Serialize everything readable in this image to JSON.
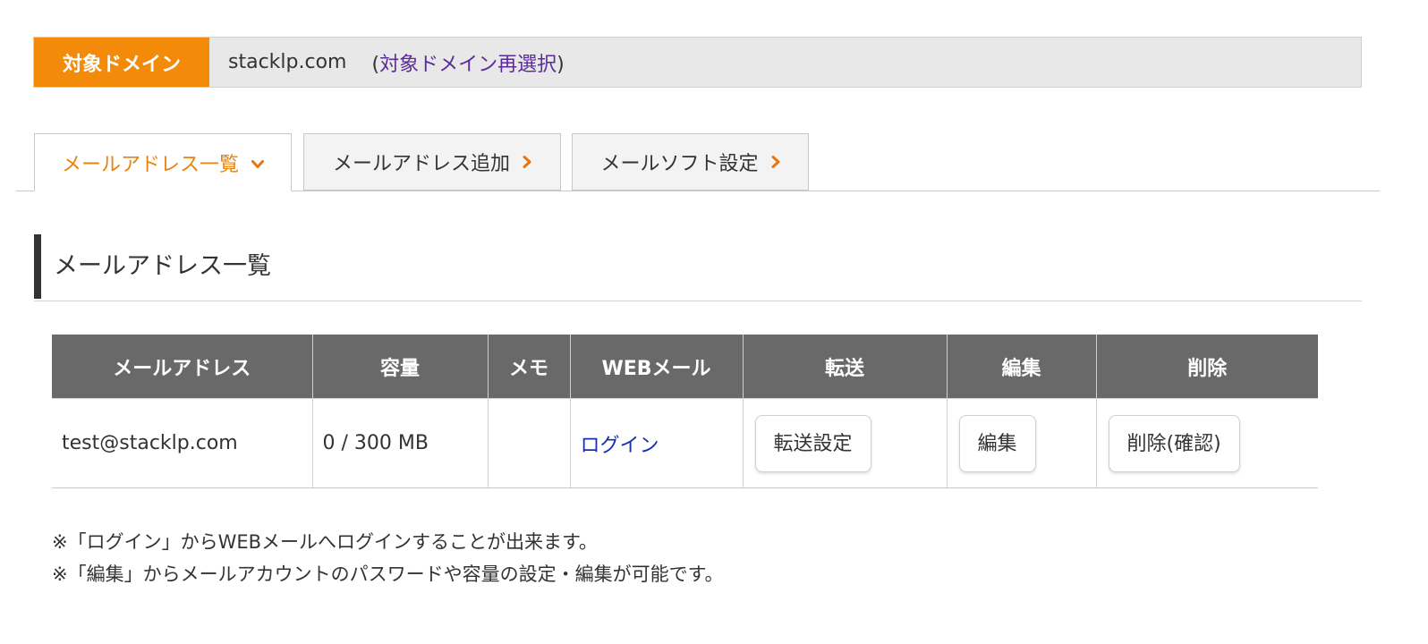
{
  "domain_bar": {
    "label": "対象ドメイン",
    "domain": "stacklp.com",
    "reselect_open": "(",
    "reselect_link": "対象ドメイン再選択",
    "reselect_close": ")"
  },
  "tabs": [
    {
      "label": "メールアドレス一覧",
      "icon": "chevron-down-icon",
      "active": true
    },
    {
      "label": "メールアドレス追加",
      "icon": "chevron-right-icon",
      "active": false
    },
    {
      "label": "メールソフト設定",
      "icon": "chevron-right-icon",
      "active": false
    }
  ],
  "section": {
    "title": "メールアドレス一覧"
  },
  "table": {
    "headers": [
      "メールアドレス",
      "容量",
      "メモ",
      "WEBメール",
      "転送",
      "編集",
      "削除"
    ],
    "rows": [
      {
        "email": "test@stacklp.com",
        "capacity": "0 / 300 MB",
        "memo": "",
        "webmail_link": "ログイン",
        "forward_button": "転送設定",
        "edit_button": "編集",
        "delete_button": "削除(確認)"
      }
    ]
  },
  "notes": [
    "※「ログイン」からWEBメールへログインすることが出来ます。",
    "※「編集」からメールアカウントのパスワードや容量の設定・編集が可能です。"
  ],
  "colors": {
    "accent_orange": "#f48a0a",
    "tab_active_text": "#e8830f",
    "header_gray": "#696969",
    "link_purple": "#5b2a9b",
    "link_blue": "#1a2fb0"
  }
}
